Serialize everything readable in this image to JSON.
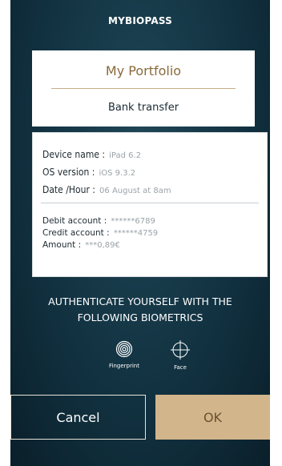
{
  "app": {
    "title": "MYBIOPASS"
  },
  "portfolio_card": {
    "title": "My Portfolio",
    "operation": "Bank transfer"
  },
  "details": {
    "device_label": "Device name :",
    "device_value": "iPad 6.2",
    "os_label": "OS version :",
    "os_value": "iOS 9.3.2",
    "date_label": "Date /Hour :",
    "date_value": "06 August at 8am",
    "debit_label": "Debit account :",
    "debit_value": "******6789",
    "credit_label": "Credit account :",
    "credit_value": "******4759",
    "amount_label": "Amount :",
    "amount_value": "***0,89€"
  },
  "auth": {
    "title_line1": "AUTHENTICATE YOURSELF WITH THE",
    "title_line2": "FOLLOWING BIOMETRICS",
    "options": [
      {
        "label": "Fingerprint",
        "icon": "fingerprint-icon"
      },
      {
        "label": "Face",
        "icon": "face-target-icon"
      }
    ]
  },
  "buttons": {
    "cancel": "Cancel",
    "ok": "OK"
  },
  "colors": {
    "background": "#123241",
    "gold": "#d2b58a",
    "portfolio_text": "#8a6a3a"
  }
}
